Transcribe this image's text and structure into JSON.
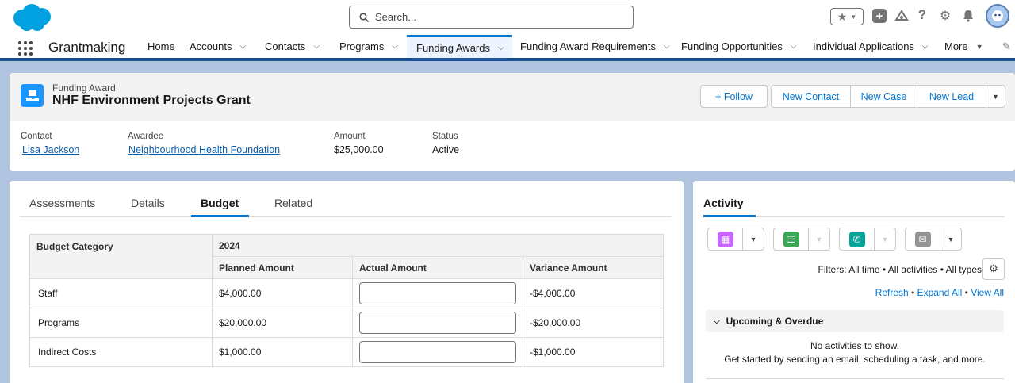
{
  "header": {
    "search_placeholder": "Search..."
  },
  "nav": {
    "app_name": "Grantmaking",
    "items": [
      "Home",
      "Accounts",
      "Contacts",
      "Programs",
      "Funding Awards",
      "Funding Award Requirements",
      "Funding Opportunities",
      "Individual Applications",
      "More"
    ],
    "active": "Funding Awards"
  },
  "record": {
    "object_label": "Funding Award",
    "title": "NHF Environment Projects Grant",
    "buttons": {
      "follow": "+ Follow",
      "new_contact": "New Contact",
      "new_case": "New Case",
      "new_lead": "New Lead"
    },
    "fields": {
      "contact_label": "Contact",
      "contact_value": "Lisa Jackson",
      "awardee_label": "Awardee",
      "awardee_value": "Neighbourhood Health Foundation",
      "amount_label": "Amount",
      "amount_value": "$25,000.00",
      "status_label": "Status",
      "status_value": "Active"
    }
  },
  "tabs": [
    "Assessments",
    "Details",
    "Budget",
    "Related"
  ],
  "active_tab": "Budget",
  "budget": {
    "col_category": "Budget Category",
    "year": "2024",
    "col_planned": "Planned Amount",
    "col_actual": "Actual Amount",
    "col_variance": "Variance Amount",
    "rows": [
      {
        "category": "Staff",
        "planned": "$4,000.00",
        "actual": "",
        "variance": "-$4,000.00"
      },
      {
        "category": "Programs",
        "planned": "$20,000.00",
        "actual": "",
        "variance": "-$20,000.00"
      },
      {
        "category": "Indirect Costs",
        "planned": "$1,000.00",
        "actual": "",
        "variance": "-$1,000.00"
      }
    ]
  },
  "activity": {
    "title": "Activity",
    "filters": "Filters: All time • All activities • All types",
    "refresh": "Refresh",
    "expand_all": "Expand All",
    "view_all": "View All",
    "upcoming": "Upcoming & Overdue",
    "empty": "No activities to show.",
    "empty_hint": "Get started by sending an email, scheduling a task, and more."
  },
  "colors": {
    "brand_blue": "#0176d3",
    "nav_bar": "#1b5297",
    "cloud": "#00a1e0"
  }
}
